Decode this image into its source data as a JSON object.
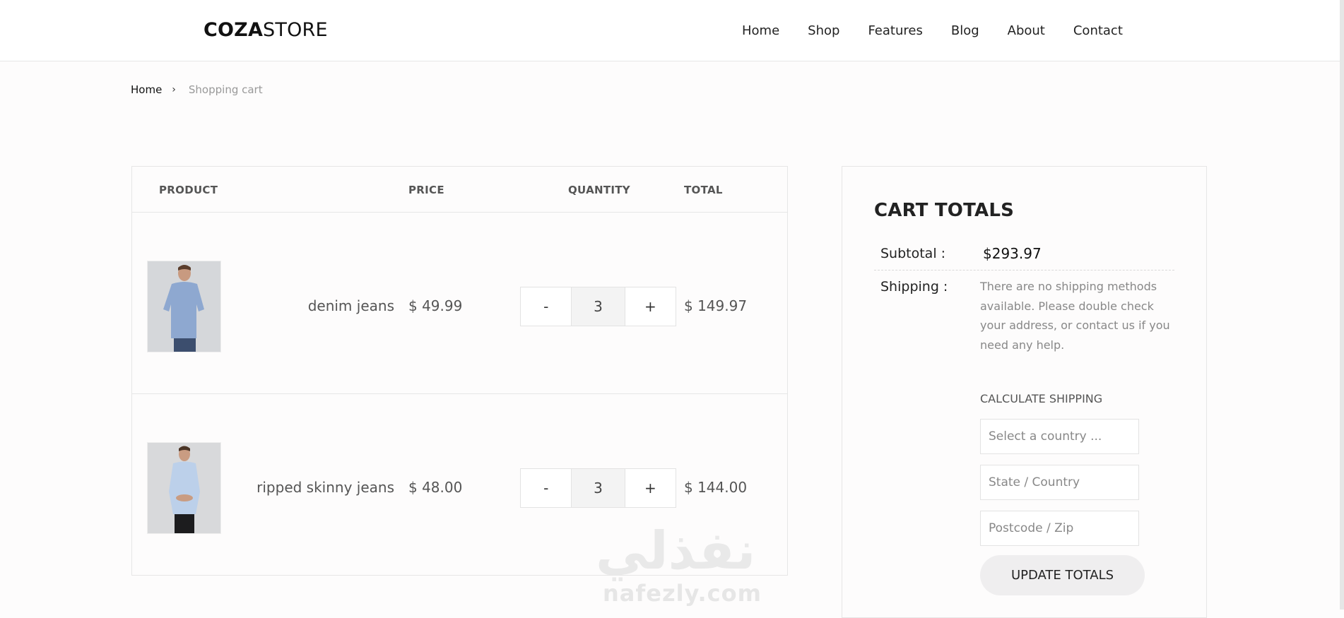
{
  "header": {
    "logo_bold": "COZA",
    "logo_light": "STORE",
    "nav": [
      "Home",
      "Shop",
      "Features",
      "Blog",
      "About",
      "Contact"
    ]
  },
  "breadcrumb": {
    "home": "Home",
    "separator": "›",
    "current": "Shopping cart"
  },
  "cart": {
    "headers": {
      "product": "PRODUCT",
      "price": "PRICE",
      "quantity": "QUANTITY",
      "total": "TOTAL"
    },
    "items": [
      {
        "name": "denim jeans",
        "price": "$ 49.99",
        "minus": "-",
        "quantity": "3",
        "plus": "+",
        "total": "$ 149.97",
        "shirt_color": "#8ea8d0"
      },
      {
        "name": "ripped skinny jeans",
        "price": "$ 48.00",
        "minus": "-",
        "quantity": "3",
        "plus": "+",
        "total": "$ 144.00",
        "shirt_color": "#bcd0ea"
      }
    ]
  },
  "totals": {
    "title": "CART TOTALS",
    "subtotal_label": "Subtotal :",
    "subtotal_value": "$293.97",
    "shipping_label": "Shipping :",
    "shipping_note": "There are no shipping methods available. Please double check your address, or contact us if you need any help.",
    "calculate_label": "CALCULATE SHIPPING",
    "country_placeholder": "Select a country ...",
    "state_placeholder": "State / Country",
    "postcode_placeholder": "Postcode / Zip",
    "update_button": "UPDATE TOTALS"
  },
  "watermark": {
    "arabic": "نفذلي",
    "latin": "nafezly.com"
  }
}
